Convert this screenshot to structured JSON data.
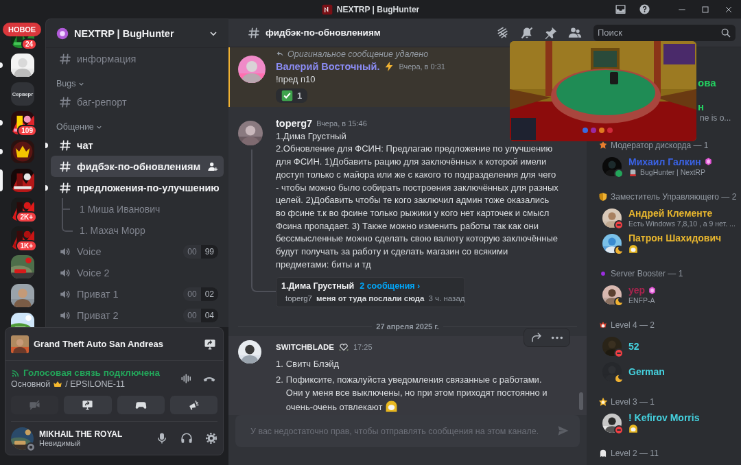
{
  "window": {
    "title": "NEXTRP | BugHunter"
  },
  "new_pill": "НОВОЕ",
  "servers": [
    {
      "kind": "picture",
      "badge": "24",
      "selected": false,
      "unread": false
    },
    {
      "kind": "picture",
      "selected": false,
      "unread": true
    },
    {
      "kind": "text",
      "label": "Серверг",
      "selected": false,
      "unread": false
    },
    {
      "kind": "picture",
      "badge": "109",
      "selected": false,
      "unread": true
    },
    {
      "kind": "picture",
      "selected": false,
      "unread": true
    },
    {
      "kind": "picture",
      "selected": true,
      "unread": false
    },
    {
      "kind": "picture",
      "badge": "2K+",
      "selected": false,
      "unread": false
    },
    {
      "kind": "picture",
      "badge": "1K+",
      "selected": false,
      "unread": false
    },
    {
      "kind": "picture",
      "selected": false,
      "unread": false
    },
    {
      "kind": "picture",
      "selected": false,
      "unread": false
    },
    {
      "kind": "picture",
      "selected": false,
      "unread": false
    }
  ],
  "server": {
    "name": "NEXTRP | BugHunter"
  },
  "channels": [
    {
      "kind": "text",
      "name": "информация",
      "unread": false,
      "selected": false
    },
    {
      "kind": "category",
      "name": "Bugs",
      "expanded": true
    },
    {
      "kind": "text",
      "name": "баг-репорт",
      "unread": false,
      "selected": false
    },
    {
      "kind": "category",
      "name": "Общение",
      "expanded": true
    },
    {
      "kind": "text",
      "name": "чат",
      "unread": true,
      "selected": false
    },
    {
      "kind": "text",
      "name": "фидбэк-по-обновлениям",
      "unread": false,
      "selected": true
    },
    {
      "kind": "text",
      "name": "предложения-по-улучшению",
      "unread": true,
      "selected": false
    },
    {
      "kind": "thread",
      "name": "1 Миша Иванович",
      "unread": false,
      "selected": false
    },
    {
      "kind": "thread",
      "name": "1. Махач Морр",
      "unread": false,
      "selected": false
    },
    {
      "kind": "voice",
      "name": "Voice",
      "count": "00",
      "limit": "99",
      "unread": false,
      "selected": false
    },
    {
      "kind": "voice",
      "name": "Voice 2",
      "unread": false,
      "selected": false
    },
    {
      "kind": "voice",
      "name": "Приват 1",
      "count": "00",
      "limit": "02",
      "unread": false,
      "selected": false
    },
    {
      "kind": "voice",
      "name": "Приват 2",
      "count": "00",
      "limit": "04",
      "unread": false,
      "selected": false
    }
  ],
  "panel": {
    "activity": {
      "game": "Grand Theft Auto San Andreas"
    },
    "voice": {
      "status": "Голосовая связь подключена",
      "channel": "Основной",
      "server": "/ EPSILONE-11"
    },
    "buttons": [
      {
        "kind": "camera",
        "disabled": true
      },
      {
        "kind": "screen",
        "disabled": false
      },
      {
        "kind": "activity",
        "disabled": false
      },
      {
        "kind": "soundboard",
        "disabled": false
      }
    ],
    "user": {
      "name": "MIKHAIL THE ROYAL",
      "status_text": "Невидимый",
      "presence": {
        "kind": "invisible"
      }
    }
  },
  "chat": {
    "channel": "фидбэк-по-обновлениям",
    "search_placeholder": "Поиск",
    "messages": [
      {
        "kind": "reply",
        "highlighted": true,
        "reply": "Оригинальное сообщение удалено",
        "author": "Валерий Восточный.",
        "color": "#8b8cf4",
        "time": "Вчера, в 0:31",
        "text": "!пред п10",
        "reactions": [
          {
            "count": "1"
          }
        ]
      },
      {
        "kind": "thread",
        "highlighted": false,
        "author": "toperg7",
        "color": "#f2f3f5",
        "time": "Вчера, в 15:46",
        "text": "1.Дима Грустный\n2.Обновление для ФСИН: Предлагаю предложение по улучшению для ФСИН. 1)Добавить рацию для заключённых к которой имели доступ только с майора или же с какого то подразделения для чего - чтобы можно было собирать построения заключённых для разных целей. 2)Добавить чтобы те кого заключил админ тоже оказались во фсине т.к во фсине только рыжики у кого нет карточек и смысл Фсина пропадает. 3) Также можно изменить работы так как они бессмысленные можно сделать свою валюту которую заключённые будут получать за работу и сделать магазин со всякими предметами: биты и тд",
        "thread": {
          "title": "1.Дима Грустный",
          "count": "2 сообщения ›",
          "last_author": "toperg7",
          "last_text": "меня от туда послали сюда",
          "ago": "3 ч. назад"
        }
      },
      {
        "kind": "divider",
        "date": "27 апреля 2025 г."
      },
      {
        "kind": "list",
        "hovered": true,
        "author": "SWITCHBLADE",
        "color": "#f2f3f5",
        "time": "17:25",
        "items": [
          {
            "num": "1.",
            "text": "Свитч Блэйд"
          },
          {
            "num": "2.",
            "text": "Пофиксите, пожалуйста уведомления связанные с работами. Они у меня все выключены, но при этом приходят постоянно и очень-очень отвлекают",
            "emoji": true
          }
        ]
      }
    ],
    "composer": {
      "placeholder": "У вас недостаточно прав, чтобы отправлять сообщения на этом канале."
    }
  },
  "members": {
    "peek": [
      {
        "kind": "name",
        "text": "ова",
        "color": "#23d160"
      },
      {
        "kind": "name",
        "text": "н",
        "color": "#23d160"
      },
      {
        "kind": "status",
        "text": "ne is o..."
      }
    ],
    "groups": [
      {
        "title": "Модератор дискорда — 1",
        "members": [
          {
            "name": "Михаил Галкин",
            "color": "#3a63e6",
            "presence": {
              "kind": "online"
            },
            "boost": true,
            "activity": "BugHunter | NextRP",
            "activity_icon": true
          }
        ]
      },
      {
        "title": "Заместитель Управляющего — 2",
        "members": [
          {
            "name": "Андрей Клементе",
            "color": "#e9b72e",
            "presence": {
              "kind": "dnd"
            },
            "activity": "Есть Windows 7,8,10 , а 9 нет. ..."
          },
          {
            "name": "Патрон Шахидович",
            "color": "#e9b72e",
            "presence": {
              "kind": "idle"
            },
            "status_emoji": true
          }
        ]
      },
      {
        "title": "Server Booster — 1",
        "members": [
          {
            "name": "yep",
            "color": "#a8234d",
            "presence": {
              "kind": "idle"
            },
            "boost": true,
            "activity": "ENFP-A"
          }
        ]
      },
      {
        "title": "Level 4 — 2",
        "members": [
          {
            "name": "52",
            "color": "#45d3e0",
            "presence": {
              "kind": "dnd"
            }
          },
          {
            "name": "German",
            "color": "#45d3e0",
            "presence": {
              "kind": "idle"
            }
          }
        ]
      },
      {
        "title": "Level 3 — 1",
        "members": [
          {
            "name": "! Kefirov Morris",
            "color": "#45d3e0",
            "presence": {
              "kind": "dnd"
            },
            "status_emoji": true
          }
        ]
      },
      {
        "title": "Level 2 — 11"
      }
    ]
  }
}
